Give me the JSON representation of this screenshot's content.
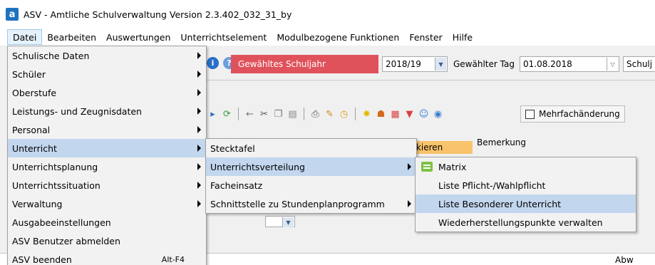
{
  "window": {
    "logo_letter": "a",
    "title": "ASV - Amtliche Schulverwaltung Version 2.3.402_032_31_by"
  },
  "menubar": {
    "items": [
      "Datei",
      "Bearbeiten",
      "Auswertungen",
      "Unterrichtselement",
      "Modulbezogene Funktionen",
      "Fenster",
      "Hilfe"
    ]
  },
  "toolbar": {
    "info_glyph": "i",
    "help_glyph": "?",
    "schuljahr_label": "Gewähltes Schuljahr",
    "schuljahr_value": "2018/19",
    "tag_label": "Gewählter Tag",
    "tag_value": "01.08.2018",
    "truncated_field": "Schulj",
    "mehrfach_label": "Mehrfachänderung",
    "markieren_label": "rkieren",
    "bemerkung_label": "Bemerkung",
    "abw_label": "Abw",
    "icons": [
      "nav-icon",
      "refresh-icon",
      "arrow-left-icon",
      "cut-icon",
      "copy-icon",
      "paste-icon",
      "print-icon",
      "broom-icon",
      "clock-icon",
      "bulb-icon",
      "users-icon",
      "chart-icon",
      "filter-icon",
      "user-tools-icon",
      "help-icon"
    ]
  },
  "datei_menu": {
    "items": [
      {
        "label": "Schulische Daten",
        "submenu": true
      },
      {
        "label": "Schüler",
        "submenu": true
      },
      {
        "label": "Oberstufe",
        "submenu": true
      },
      {
        "label": "Leistungs- und Zeugnisdaten",
        "submenu": true
      },
      {
        "label": "Personal",
        "submenu": true
      },
      {
        "label": "Unterricht",
        "submenu": true,
        "highlighted": true
      },
      {
        "label": "Unterrichtsplanung",
        "submenu": true
      },
      {
        "label": "Unterrichtssituation",
        "submenu": true
      },
      {
        "label": "Verwaltung",
        "submenu": true
      },
      {
        "label": "Ausgabeeinstellungen",
        "submenu": false
      },
      {
        "label": "ASV Benutzer abmelden",
        "submenu": false
      },
      {
        "label": "ASV beenden",
        "submenu": false,
        "shortcut": "Alt-F4"
      }
    ]
  },
  "unterricht_menu": {
    "items": [
      {
        "label": "Stecktafel",
        "submenu": false
      },
      {
        "label": "Unterrichtsverteilung",
        "submenu": true,
        "highlighted": true
      },
      {
        "label": "Facheinsatz",
        "submenu": false
      },
      {
        "label": "Schnittstelle zu Stundenplanprogramm",
        "submenu": true
      }
    ]
  },
  "verteilung_menu": {
    "items": [
      {
        "label": "Matrix",
        "icon": "matrix-icon"
      },
      {
        "label": "Liste Pflicht-/Wahlpflicht"
      },
      {
        "label": "Liste Besonderer Unterricht",
        "highlighted": true
      },
      {
        "label": "Wiederherstellungspunkte verwalten"
      }
    ]
  },
  "colors": {
    "schuljahr_bg": "#e0525b",
    "highlight": "#c2d6ee",
    "markieren_bg": "#f9c36b",
    "menu_bg": "#f2f2f2"
  }
}
